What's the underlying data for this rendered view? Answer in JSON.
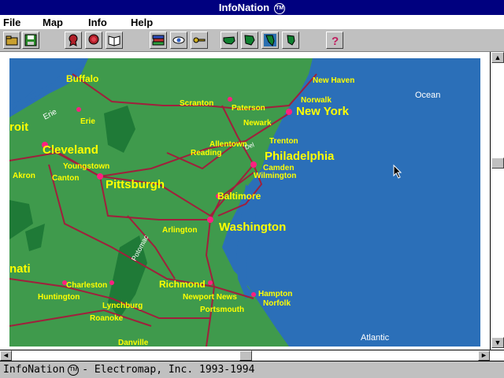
{
  "window": {
    "title": "InfoNation",
    "tm": "TM"
  },
  "menu": {
    "file": "File",
    "map": "Map",
    "info": "Info",
    "help": "Help"
  },
  "toolbar": {
    "buttons": [
      "folder-open-icon",
      "save-disk-icon",
      "award-ribbon-icon",
      "award-rosette-icon",
      "open-book-icon",
      "stacked-books-icon",
      "eye-icon",
      "key-icon",
      "usa-map-icon",
      "region-map-icon",
      "state-map-icon",
      "state-outline-icon",
      "question-help-icon"
    ]
  },
  "map": {
    "cities": [
      {
        "name": "Buffalo",
        "size": "small"
      },
      {
        "name": "New Haven",
        "size": "small"
      },
      {
        "name": "Norwalk",
        "size": "small"
      },
      {
        "name": "New York",
        "size": "large"
      },
      {
        "name": "Scranton",
        "size": "small"
      },
      {
        "name": "Paterson",
        "size": "small"
      },
      {
        "name": "Newark",
        "size": "small"
      },
      {
        "name": "Erie",
        "size": "small"
      },
      {
        "name": "roit",
        "size": "large"
      },
      {
        "name": "Trenton",
        "size": "small"
      },
      {
        "name": "Allentown",
        "size": "small"
      },
      {
        "name": "Reading",
        "size": "small"
      },
      {
        "name": "Philadelphia",
        "size": "large"
      },
      {
        "name": "Cleveland",
        "size": "large"
      },
      {
        "name": "Camden",
        "size": "small"
      },
      {
        "name": "Wilmington",
        "size": "small"
      },
      {
        "name": "Youngstown",
        "size": "small"
      },
      {
        "name": "Akron",
        "size": "small"
      },
      {
        "name": "Canton",
        "size": "small"
      },
      {
        "name": "Pittsburgh",
        "size": "large"
      },
      {
        "name": "Baltimore",
        "size": "medium"
      },
      {
        "name": "Washington",
        "size": "large"
      },
      {
        "name": "Arlington",
        "size": "small"
      },
      {
        "name": "nati",
        "size": "large"
      },
      {
        "name": "Charleston",
        "size": "small"
      },
      {
        "name": "Richmond",
        "size": "medium"
      },
      {
        "name": "Huntington",
        "size": "small"
      },
      {
        "name": "Newport News",
        "size": "small"
      },
      {
        "name": "Hampton",
        "size": "small"
      },
      {
        "name": "Norfolk",
        "size": "small"
      },
      {
        "name": "Portsmouth",
        "size": "small"
      },
      {
        "name": "Lynchburg",
        "size": "small"
      },
      {
        "name": "Roanoke",
        "size": "small"
      },
      {
        "name": "Danville",
        "size": "small"
      }
    ],
    "water_labels": [
      "Ocean",
      "Atlantic",
      "Erie",
      "Potomac",
      "Del"
    ],
    "colors": {
      "ocean": "#2b6fb8",
      "land": "#3f9a4c",
      "forest": "#1f7a37",
      "roads": "#a0203c",
      "city_text": "#ffff00"
    }
  },
  "status": {
    "app": "InfoNation",
    "tm": "TM",
    "text": "- Electromap, Inc. 1993-1994"
  }
}
